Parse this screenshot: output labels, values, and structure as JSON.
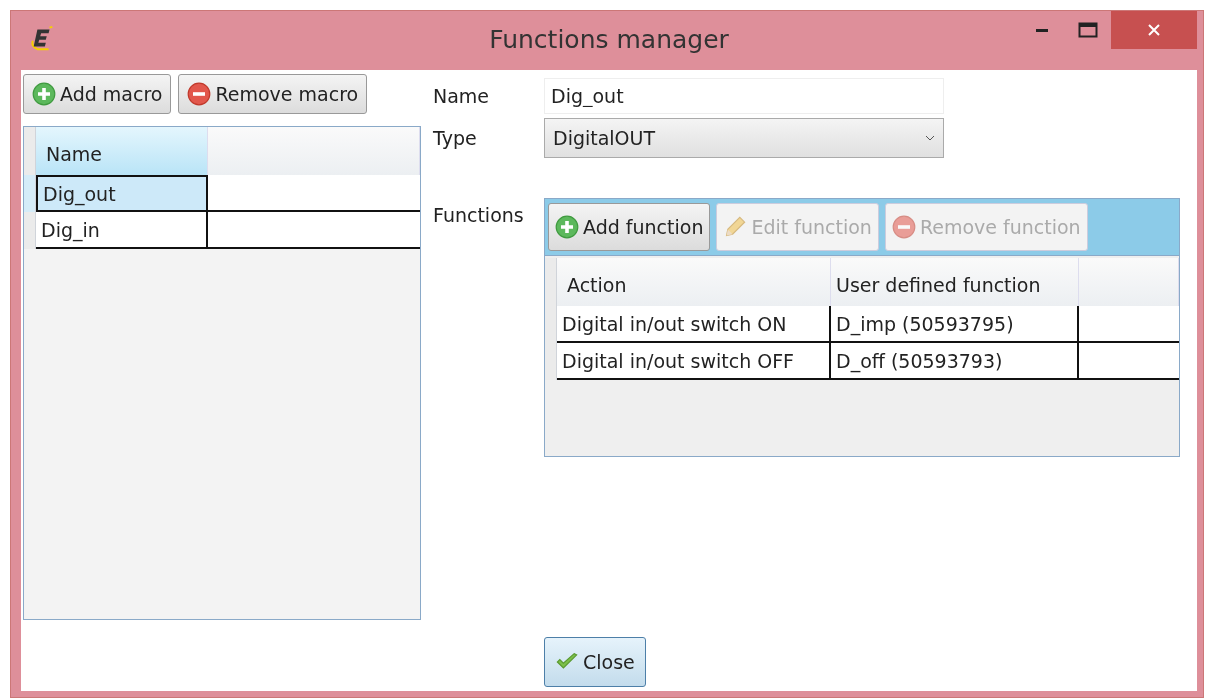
{
  "window": {
    "title": "Functions manager"
  },
  "macro_toolbar": [
    {
      "label": "Add macro",
      "kind": "add",
      "disabled": false
    },
    {
      "label": "Remove macro",
      "kind": "remove",
      "disabled": false
    }
  ],
  "macro_table": {
    "columns": [
      "Name"
    ],
    "rows": [
      {
        "name": "Dig_out",
        "selected": true
      },
      {
        "name": "Dig_in",
        "selected": false
      }
    ]
  },
  "form": {
    "name_label": "Name",
    "name_value": "Dig_out",
    "type_label": "Type",
    "type_value": "DigitalOUT",
    "functions_label": "Functions"
  },
  "function_toolbar": [
    {
      "label": "Add function",
      "kind": "add",
      "disabled": false
    },
    {
      "label": "Edit function",
      "kind": "edit",
      "disabled": true
    },
    {
      "label": "Remove function",
      "kind": "remove",
      "disabled": true
    }
  ],
  "function_table": {
    "columns": [
      "Action",
      "User defined function"
    ],
    "rows": [
      [
        "Digital in/out switch ON",
        "D_imp (50593795)"
      ],
      [
        "Digital in/out switch OFF",
        "D_off (50593793)"
      ]
    ]
  },
  "footer": {
    "button": {
      "label": "Close",
      "kind": "confirm",
      "disabled": false
    }
  }
}
